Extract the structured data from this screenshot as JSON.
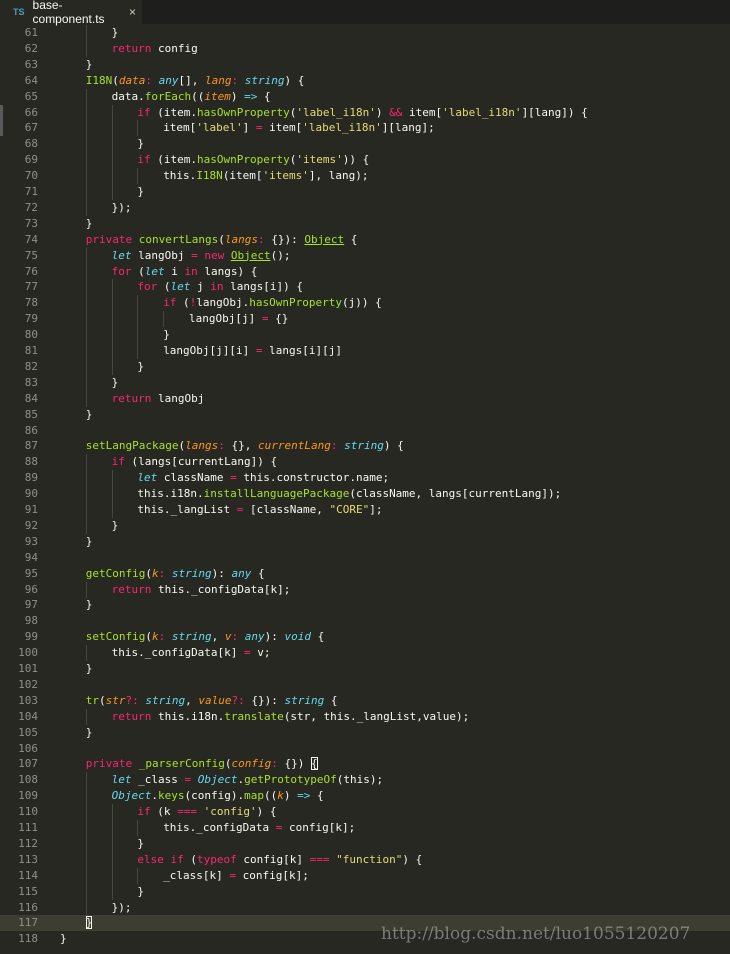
{
  "tab": {
    "lang_badge": "TS",
    "filename": "base-component.ts",
    "close": "×"
  },
  "watermark": "http://blog.csdn.net/luo1055120207",
  "lines": [
    {
      "n": "61",
      "i": 2,
      "t": [
        [
          "p",
          "}"
        ]
      ]
    },
    {
      "n": "62",
      "i": 2,
      "t": [
        [
          "k",
          "return"
        ],
        [
          "p",
          " config"
        ]
      ]
    },
    {
      "n": "63",
      "i": 1,
      "t": [
        [
          "p",
          "}"
        ]
      ]
    },
    {
      "n": "64",
      "i": 1,
      "t": [
        [
          "f",
          "I18N"
        ],
        [
          "p",
          "("
        ],
        [
          "a",
          "data"
        ],
        [
          "k",
          ":"
        ],
        [
          "p",
          " "
        ],
        [
          "y",
          "any"
        ],
        [
          "p",
          "[], "
        ],
        [
          "a",
          "lang"
        ],
        [
          "k",
          ":"
        ],
        [
          "p",
          " "
        ],
        [
          "y",
          "string"
        ],
        [
          "p",
          ") {"
        ]
      ]
    },
    {
      "n": "65",
      "i": 2,
      "t": [
        [
          "p",
          "data."
        ],
        [
          "f",
          "forEach"
        ],
        [
          "p",
          "(("
        ],
        [
          "a",
          "item"
        ],
        [
          "p",
          ") "
        ],
        [
          "y",
          "=>"
        ],
        [
          "p",
          " {"
        ]
      ]
    },
    {
      "n": "66",
      "i": 3,
      "t": [
        [
          "k",
          "if"
        ],
        [
          "p",
          " (item."
        ],
        [
          "f",
          "hasOwnProperty"
        ],
        [
          "p",
          "("
        ],
        [
          "s",
          "'label_i18n'"
        ],
        [
          "p",
          ") "
        ],
        [
          "k",
          "&&"
        ],
        [
          "p",
          " item["
        ],
        [
          "s",
          "'label_i18n'"
        ],
        [
          "p",
          "][lang]) {"
        ]
      ]
    },
    {
      "n": "67",
      "i": 4,
      "t": [
        [
          "p",
          "item["
        ],
        [
          "s",
          "'label'"
        ],
        [
          "p",
          "] "
        ],
        [
          "k",
          "="
        ],
        [
          "p",
          " item["
        ],
        [
          "s",
          "'label_i18n'"
        ],
        [
          "p",
          "][lang];"
        ]
      ]
    },
    {
      "n": "68",
      "i": 3,
      "t": [
        [
          "p",
          "}"
        ]
      ]
    },
    {
      "n": "69",
      "i": 3,
      "t": [
        [
          "k",
          "if"
        ],
        [
          "p",
          " (item."
        ],
        [
          "f",
          "hasOwnProperty"
        ],
        [
          "p",
          "("
        ],
        [
          "s",
          "'items'"
        ],
        [
          "p",
          ")) {"
        ]
      ]
    },
    {
      "n": "70",
      "i": 4,
      "t": [
        [
          "p",
          "this."
        ],
        [
          "f",
          "I18N"
        ],
        [
          "p",
          "(item["
        ],
        [
          "s",
          "'items'"
        ],
        [
          "p",
          "], lang);"
        ]
      ]
    },
    {
      "n": "71",
      "i": 3,
      "t": [
        [
          "p",
          "}"
        ]
      ]
    },
    {
      "n": "72",
      "i": 2,
      "t": [
        [
          "p",
          "});"
        ]
      ]
    },
    {
      "n": "73",
      "i": 1,
      "t": [
        [
          "p",
          "}"
        ]
      ]
    },
    {
      "n": "74",
      "i": 1,
      "t": [
        [
          "k",
          "private"
        ],
        [
          "p",
          " "
        ],
        [
          "f",
          "convertLangs"
        ],
        [
          "p",
          "("
        ],
        [
          "a",
          "langs"
        ],
        [
          "k",
          ":"
        ],
        [
          "p",
          " {}): "
        ],
        [
          "u",
          "Object"
        ],
        [
          "p",
          " {"
        ]
      ]
    },
    {
      "n": "75",
      "i": 2,
      "t": [
        [
          "l",
          "let"
        ],
        [
          "p",
          " langObj "
        ],
        [
          "k",
          "="
        ],
        [
          "p",
          " "
        ],
        [
          "k",
          "new"
        ],
        [
          "p",
          " "
        ],
        [
          "u",
          "Object"
        ],
        [
          "p",
          "();"
        ]
      ]
    },
    {
      "n": "76",
      "i": 2,
      "t": [
        [
          "k",
          "for"
        ],
        [
          "p",
          " ("
        ],
        [
          "l",
          "let"
        ],
        [
          "p",
          " i "
        ],
        [
          "k",
          "in"
        ],
        [
          "p",
          " langs) {"
        ]
      ]
    },
    {
      "n": "77",
      "i": 3,
      "t": [
        [
          "k",
          "for"
        ],
        [
          "p",
          " ("
        ],
        [
          "l",
          "let"
        ],
        [
          "p",
          " j "
        ],
        [
          "k",
          "in"
        ],
        [
          "p",
          " langs[i]) {"
        ]
      ]
    },
    {
      "n": "78",
      "i": 4,
      "t": [
        [
          "k",
          "if"
        ],
        [
          "p",
          " ("
        ],
        [
          "k",
          "!"
        ],
        [
          "p",
          "langObj."
        ],
        [
          "f",
          "hasOwnProperty"
        ],
        [
          "p",
          "(j)) {"
        ]
      ]
    },
    {
      "n": "79",
      "i": 5,
      "t": [
        [
          "p",
          "langObj[j] "
        ],
        [
          "k",
          "="
        ],
        [
          "p",
          " {}"
        ]
      ]
    },
    {
      "n": "80",
      "i": 4,
      "t": [
        [
          "p",
          "}"
        ]
      ]
    },
    {
      "n": "81",
      "i": 4,
      "t": [
        [
          "p",
          "langObj[j][i] "
        ],
        [
          "k",
          "="
        ],
        [
          "p",
          " langs[i][j]"
        ]
      ]
    },
    {
      "n": "82",
      "i": 3,
      "t": [
        [
          "p",
          "}"
        ]
      ]
    },
    {
      "n": "83",
      "i": 2,
      "t": [
        [
          "p",
          "}"
        ]
      ]
    },
    {
      "n": "84",
      "i": 2,
      "t": [
        [
          "k",
          "return"
        ],
        [
          "p",
          " langObj"
        ]
      ]
    },
    {
      "n": "85",
      "i": 1,
      "t": [
        [
          "p",
          "}"
        ]
      ]
    },
    {
      "n": "86",
      "i": 0,
      "t": []
    },
    {
      "n": "87",
      "i": 1,
      "t": [
        [
          "f",
          "setLangPackage"
        ],
        [
          "p",
          "("
        ],
        [
          "a",
          "langs"
        ],
        [
          "k",
          ":"
        ],
        [
          "p",
          " {}, "
        ],
        [
          "a",
          "currentLang"
        ],
        [
          "k",
          ":"
        ],
        [
          "p",
          " "
        ],
        [
          "y",
          "string"
        ],
        [
          "p",
          ") {"
        ]
      ]
    },
    {
      "n": "88",
      "i": 2,
      "t": [
        [
          "k",
          "if"
        ],
        [
          "p",
          " (langs[currentLang]) {"
        ]
      ]
    },
    {
      "n": "89",
      "i": 3,
      "t": [
        [
          "l",
          "let"
        ],
        [
          "p",
          " className "
        ],
        [
          "k",
          "="
        ],
        [
          "p",
          " this.constructor.name;"
        ]
      ]
    },
    {
      "n": "90",
      "i": 3,
      "t": [
        [
          "p",
          "this.i18n."
        ],
        [
          "f",
          "installLanguagePackage"
        ],
        [
          "p",
          "(className, langs[currentLang]);"
        ]
      ]
    },
    {
      "n": "91",
      "i": 3,
      "t": [
        [
          "p",
          "this._langList "
        ],
        [
          "k",
          "="
        ],
        [
          "p",
          " [className, "
        ],
        [
          "s",
          "\"CORE\""
        ],
        [
          "p",
          "];"
        ]
      ]
    },
    {
      "n": "92",
      "i": 2,
      "t": [
        [
          "p",
          "}"
        ]
      ]
    },
    {
      "n": "93",
      "i": 1,
      "t": [
        [
          "p",
          "}"
        ]
      ]
    },
    {
      "n": "94",
      "i": 0,
      "t": []
    },
    {
      "n": "95",
      "i": 1,
      "t": [
        [
          "f",
          "getConfig"
        ],
        [
          "p",
          "("
        ],
        [
          "a",
          "k"
        ],
        [
          "k",
          ":"
        ],
        [
          "p",
          " "
        ],
        [
          "y",
          "string"
        ],
        [
          "p",
          "): "
        ],
        [
          "y",
          "any"
        ],
        [
          "p",
          " {"
        ]
      ]
    },
    {
      "n": "96",
      "i": 2,
      "t": [
        [
          "k",
          "return"
        ],
        [
          "p",
          " this._configData[k];"
        ]
      ]
    },
    {
      "n": "97",
      "i": 1,
      "t": [
        [
          "p",
          "}"
        ]
      ]
    },
    {
      "n": "98",
      "i": 0,
      "t": []
    },
    {
      "n": "99",
      "i": 1,
      "t": [
        [
          "f",
          "setConfig"
        ],
        [
          "p",
          "("
        ],
        [
          "a",
          "k"
        ],
        [
          "k",
          ":"
        ],
        [
          "p",
          " "
        ],
        [
          "y",
          "string"
        ],
        [
          "p",
          ", "
        ],
        [
          "a",
          "v"
        ],
        [
          "k",
          ":"
        ],
        [
          "p",
          " "
        ],
        [
          "y",
          "any"
        ],
        [
          "p",
          "): "
        ],
        [
          "y",
          "void"
        ],
        [
          "p",
          " {"
        ]
      ]
    },
    {
      "n": "100",
      "i": 2,
      "t": [
        [
          "p",
          "this._configData[k] "
        ],
        [
          "k",
          "="
        ],
        [
          "p",
          " v;"
        ]
      ]
    },
    {
      "n": "101",
      "i": 1,
      "t": [
        [
          "p",
          "}"
        ]
      ]
    },
    {
      "n": "102",
      "i": 0,
      "t": []
    },
    {
      "n": "103",
      "i": 1,
      "t": [
        [
          "f",
          "tr"
        ],
        [
          "p",
          "("
        ],
        [
          "a",
          "str"
        ],
        [
          "k",
          "?:"
        ],
        [
          "p",
          " "
        ],
        [
          "y",
          "string"
        ],
        [
          "p",
          ", "
        ],
        [
          "a",
          "value"
        ],
        [
          "k",
          "?:"
        ],
        [
          "p",
          " {}): "
        ],
        [
          "y",
          "string"
        ],
        [
          "p",
          " {"
        ]
      ]
    },
    {
      "n": "104",
      "i": 2,
      "t": [
        [
          "k",
          "return"
        ],
        [
          "p",
          " this.i18n."
        ],
        [
          "f",
          "translate"
        ],
        [
          "p",
          "(str, this._langList,value);"
        ]
      ]
    },
    {
      "n": "105",
      "i": 1,
      "t": [
        [
          "p",
          "}"
        ]
      ]
    },
    {
      "n": "106",
      "i": 0,
      "t": []
    },
    {
      "n": "107",
      "i": 1,
      "t": [
        [
          "k",
          "private"
        ],
        [
          "p",
          " "
        ],
        [
          "f",
          "_parserConfig"
        ],
        [
          "p",
          "("
        ],
        [
          "a",
          "config"
        ],
        [
          "k",
          ":"
        ],
        [
          "p",
          " {}) "
        ],
        [
          "b",
          "{"
        ]
      ]
    },
    {
      "n": "108",
      "i": 2,
      "t": [
        [
          "l",
          "let"
        ],
        [
          "p",
          " _class "
        ],
        [
          "k",
          "="
        ],
        [
          "p",
          " "
        ],
        [
          "y",
          "Object"
        ],
        [
          "p",
          "."
        ],
        [
          "f",
          "getPrototypeOf"
        ],
        [
          "p",
          "(this);"
        ]
      ]
    },
    {
      "n": "109",
      "i": 2,
      "t": [
        [
          "y",
          "Object"
        ],
        [
          "p",
          "."
        ],
        [
          "f",
          "keys"
        ],
        [
          "p",
          "(config)."
        ],
        [
          "f",
          "map"
        ],
        [
          "p",
          "(("
        ],
        [
          "a",
          "k"
        ],
        [
          "p",
          ") "
        ],
        [
          "y",
          "=>"
        ],
        [
          "p",
          " {"
        ]
      ]
    },
    {
      "n": "110",
      "i": 3,
      "t": [
        [
          "k",
          "if"
        ],
        [
          "p",
          " (k "
        ],
        [
          "k",
          "==="
        ],
        [
          "p",
          " "
        ],
        [
          "s",
          "'config'"
        ],
        [
          "p",
          ") {"
        ]
      ]
    },
    {
      "n": "111",
      "i": 4,
      "t": [
        [
          "p",
          "this._configData "
        ],
        [
          "k",
          "="
        ],
        [
          "p",
          " config[k];"
        ]
      ]
    },
    {
      "n": "112",
      "i": 3,
      "t": [
        [
          "p",
          "}"
        ]
      ]
    },
    {
      "n": "113",
      "i": 3,
      "t": [
        [
          "k",
          "else"
        ],
        [
          "p",
          " "
        ],
        [
          "k",
          "if"
        ],
        [
          "p",
          " ("
        ],
        [
          "k",
          "typeof"
        ],
        [
          "p",
          " config[k] "
        ],
        [
          "k",
          "==="
        ],
        [
          "p",
          " "
        ],
        [
          "s",
          "\"function\""
        ],
        [
          "p",
          ") {"
        ]
      ]
    },
    {
      "n": "114",
      "i": 4,
      "t": [
        [
          "p",
          "_class[k] "
        ],
        [
          "k",
          "="
        ],
        [
          "p",
          " config[k];"
        ]
      ]
    },
    {
      "n": "115",
      "i": 3,
      "t": [
        [
          "p",
          "}"
        ]
      ]
    },
    {
      "n": "116",
      "i": 2,
      "t": [
        [
          "p",
          "});"
        ]
      ]
    },
    {
      "n": "117",
      "i": 1,
      "t": [
        [
          "b",
          "}"
        ]
      ],
      "active": true
    },
    {
      "n": "118",
      "i": 0,
      "t": [
        [
          "p",
          "}"
        ]
      ]
    }
  ],
  "colors": {
    "background": "#272822",
    "keyword": "#f92672",
    "function": "#a6e22e",
    "string": "#e6db74",
    "type": "#66d9ef",
    "parameter": "#fd971f",
    "line_number": "#90908a"
  }
}
